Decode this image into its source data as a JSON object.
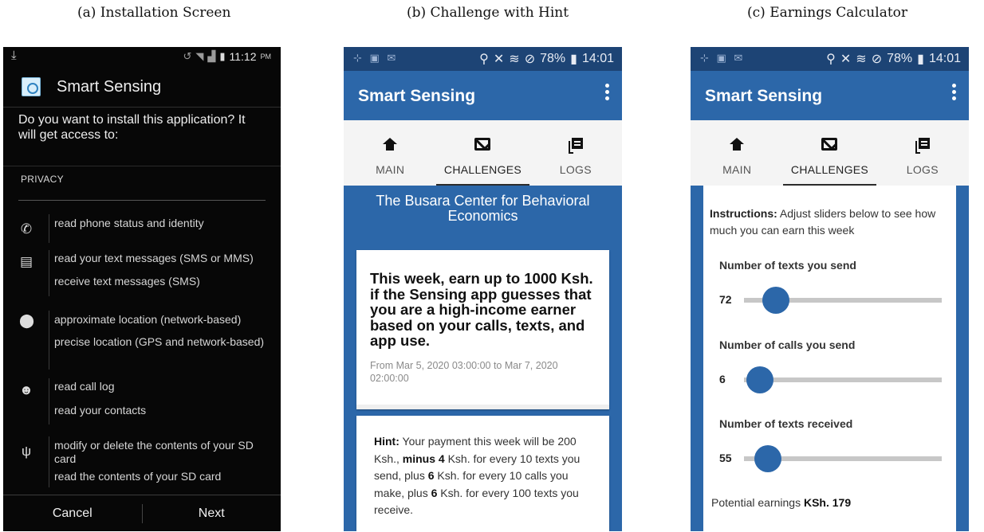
{
  "captions": {
    "a": "(a) Installation Screen",
    "b": "(b) Challenge with Hint",
    "c": "(c) Earnings Calculator"
  },
  "install": {
    "status_time": "11:12",
    "status_ampm": "PM",
    "app_name": "Smart Sensing",
    "question": "Do you want to install this application? It will get access to:",
    "section": "PRIVACY",
    "permissions": [
      {
        "icon": "phone-icon",
        "lines": [
          "read phone status and identity"
        ]
      },
      {
        "icon": "message-icon",
        "lines": [
          "read your text messages (SMS or MMS)",
          "receive text messages (SMS)"
        ]
      },
      {
        "icon": "location-pin-icon",
        "lines": [
          "approximate location (network-based)",
          "precise location (GPS and network-based)"
        ]
      },
      {
        "icon": "contacts-icon",
        "lines": [
          "read call log",
          "read your contacts"
        ]
      },
      {
        "icon": "usb-icon",
        "lines": [
          "modify or delete the contents of your SD card",
          "read the contents of your SD card"
        ]
      }
    ],
    "cancel": "Cancel",
    "next": "Next"
  },
  "app": {
    "status_battery": "78%",
    "status_time": "14:01",
    "title": "Smart Sensing",
    "tabs": [
      "MAIN",
      "CHALLENGES",
      "LOGS"
    ],
    "active_tab": "CHALLENGES"
  },
  "challenge": {
    "org": "The Busara Center for Behavioral Economics",
    "headline": "This week, earn up to 1000 Ksh. if the Sensing app guesses that you are a high-income earner based on your calls, texts, and app use.",
    "dates": "From Mar 5, 2020 03:00:00 to Mar 7, 2020 02:00:00",
    "hint_label": "Hint:",
    "hint_p1": " Your payment this week will be 200 Ksh., ",
    "hint_minus": "minus 4",
    "hint_p2": " Ksh. for every 10 texts you send, plus ",
    "hint_plus6a": "6",
    "hint_p3": " Ksh. for every 10 calls you make, plus ",
    "hint_plus6b": "6",
    "hint_p4": " Ksh. for every 100 texts you receive."
  },
  "calculator": {
    "instr_label": "Instructions:",
    "instr_text": " Adjust sliders below to see how much you can earn this week",
    "sliders": [
      {
        "label": "Number of texts you send",
        "value": "72",
        "fraction": 0.16
      },
      {
        "label": "Number of calls you send",
        "value": "6",
        "fraction": 0.08
      },
      {
        "label": "Number of texts received",
        "value": "55",
        "fraction": 0.12
      }
    ],
    "earnings_label": "Potential earnings ",
    "earnings_value": "KSh. 179"
  }
}
